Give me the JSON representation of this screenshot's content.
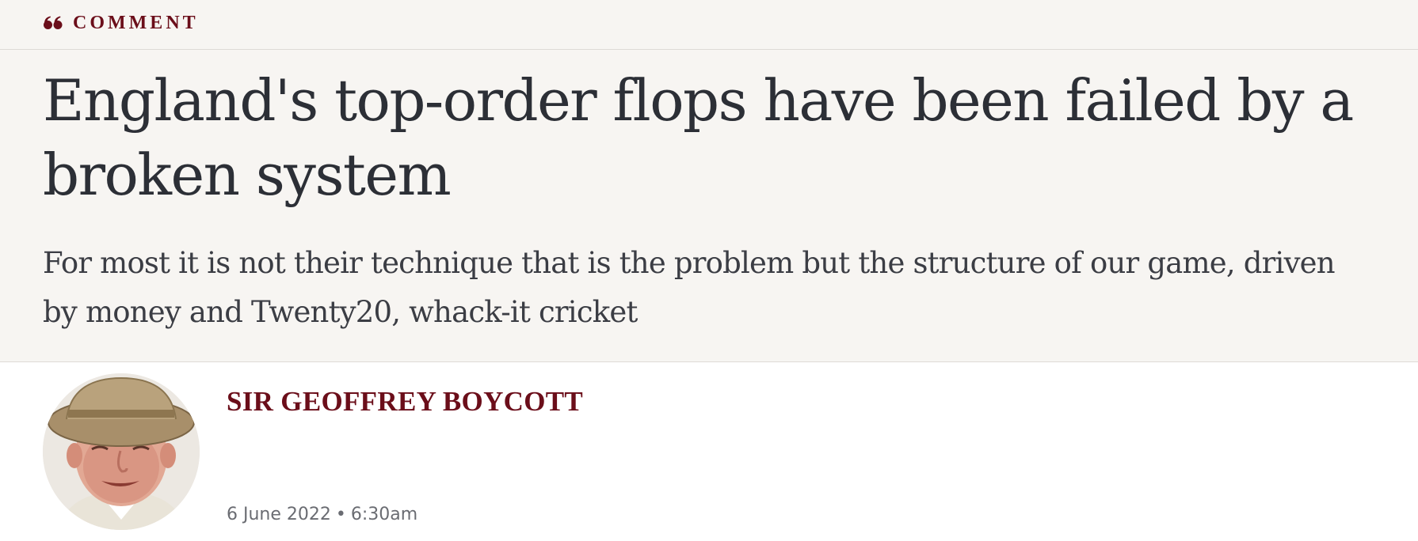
{
  "section": {
    "icon": "quote-icon",
    "label": "COMMENT",
    "color": "#6b0e1a"
  },
  "article": {
    "headline": "England's top-order flops have been failed by a broken system",
    "standfirst": "For most it is not their technique that is the problem but the structure of our game, driven by money and Twenty20, whack-it cricket"
  },
  "author": {
    "name": "SIR GEOFFREY BOYCOTT",
    "avatar_icon": "author-photo",
    "color": "#6b0e1a"
  },
  "published": {
    "date": "6 June 2022",
    "separator": "•",
    "time": "6:30am"
  }
}
